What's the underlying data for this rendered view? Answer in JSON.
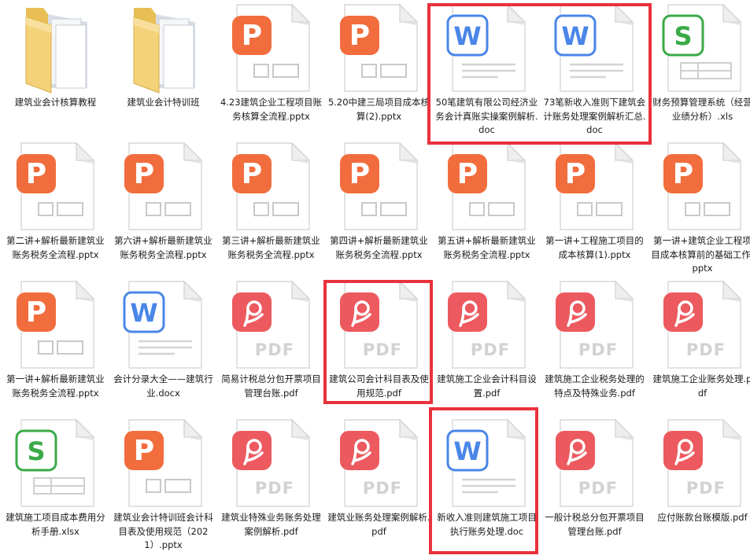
{
  "colors": {
    "ppt": "#f26d3d",
    "pdf": "#ec5a5f",
    "word": "#4a86e8",
    "excel": "#3aaa47",
    "folder": "#f4d27a",
    "highlight": "#e8323c"
  },
  "files": [
    {
      "name": "建筑业会计核算教程",
      "type": "folder"
    },
    {
      "name": "建筑业会计特训班",
      "type": "folder"
    },
    {
      "name": "4.23建筑企业工程项目账务核算全流程.pptx",
      "type": "ppt"
    },
    {
      "name": "5.20中建三局项目成本核算(2).pptx",
      "type": "ppt"
    },
    {
      "name": "50笔建筑有限公司经济业务会计真账实操案例解析.doc",
      "type": "word"
    },
    {
      "name": "73笔新收入准则下建筑会计账务处理案例解析汇总.doc",
      "type": "word"
    },
    {
      "name": "财务预算管理系统（经营业绩分析）.xls",
      "type": "excel"
    },
    {
      "name": "第二讲+解析最新建筑业账务税务全流程.pptx",
      "type": "ppt"
    },
    {
      "name": "第六讲+解析最新建筑业账务税务全流程.pptx",
      "type": "ppt"
    },
    {
      "name": "第三讲+解析最新建筑业账务税务全流程.pptx",
      "type": "ppt"
    },
    {
      "name": "第四讲+解析最新建筑业账务税务全流程.pptx",
      "type": "ppt"
    },
    {
      "name": "第五讲+解析最新建筑业账务税务全流程.pptx",
      "type": "ppt"
    },
    {
      "name": "第一讲+工程施工项目的成本核算(1).pptx",
      "type": "ppt"
    },
    {
      "name": "第一讲+建筑企业工程项目成本核算前的基础工作.pptx",
      "type": "ppt"
    },
    {
      "name": "第一讲+解析最新建筑业账务税务全流程.pptx",
      "type": "ppt"
    },
    {
      "name": "会计分录大全——建筑行业.docx",
      "type": "word"
    },
    {
      "name": "简易计税总分包开票项目管理台账.pdf",
      "type": "pdf"
    },
    {
      "name": "建筑公司会计科目表及使用规范.pdf",
      "type": "pdf"
    },
    {
      "name": "建筑施工企业会计科目设置.pdf",
      "type": "pdf"
    },
    {
      "name": "建筑施工企业税务处理的特点及特殊业务.pdf",
      "type": "pdf"
    },
    {
      "name": "建筑施工企业账务处理.pdf",
      "type": "pdf"
    },
    {
      "name": "建筑施工项目成本费用分析手册.xlsx",
      "type": "excel"
    },
    {
      "name": "建筑业会计特训班会计科目表及使用规范（2021）.pptx",
      "type": "ppt"
    },
    {
      "name": "建筑业特殊业务账务处理案例解析.pdf",
      "type": "pdf"
    },
    {
      "name": "建筑业账务处理案例解析.pdf",
      "type": "pdf"
    },
    {
      "name": "新收入准则建筑施工项目执行账务处理.doc",
      "type": "word"
    },
    {
      "name": "一般计税总分包开票项目管理台账.pdf",
      "type": "pdf"
    },
    {
      "name": "应付账款台账模版.pdf",
      "type": "pdf"
    }
  ],
  "pdf_text": "PDF",
  "glyphs": {
    "ppt": "P",
    "word": "W",
    "excel": "S"
  }
}
